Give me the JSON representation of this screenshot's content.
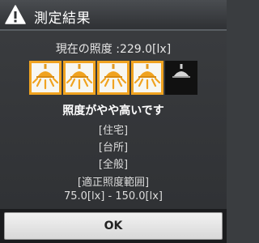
{
  "dialog": {
    "title": "測定結果",
    "icon": "warning-icon"
  },
  "measurement": {
    "current_lux_text": "現在の照度 :229.0[lx]",
    "lamps_lit": 4,
    "lamps_total": 5,
    "verdict": "照度がやや高いです"
  },
  "places": [
    "[住宅]",
    "[台所]",
    "[全般]"
  ],
  "range": {
    "title": "[適正照度範囲]",
    "value": "75.0[lx] - 150.0[lx]"
  },
  "buttons": {
    "ok_label": "OK"
  },
  "colors": {
    "lamp_on_border": "#f0a320",
    "lamp_on_fill": "#f7f7f2",
    "lamp_off": "#111111"
  }
}
